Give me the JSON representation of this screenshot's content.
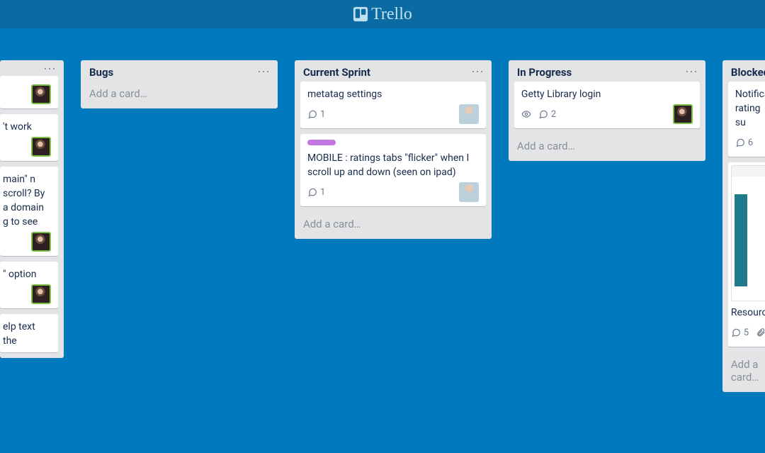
{
  "app": {
    "name": "Trello"
  },
  "add_card_label": "Add a card…",
  "lists": [
    {
      "id": "cutoff_left",
      "title": "",
      "cards": [
        {
          "title": "",
          "comments": null,
          "avatar": "av1"
        },
        {
          "title": "'t work",
          "comments": null,
          "avatar": "av1"
        },
        {
          "title": "main\" n scroll? By a domain g to see",
          "comments": null,
          "avatar": "av1"
        },
        {
          "title": "\" option",
          "comments": null,
          "avatar": "av1"
        },
        {
          "title": "elp text the",
          "comments": null,
          "avatar": null
        }
      ]
    },
    {
      "id": "bugs",
      "title": "Bugs",
      "cards": []
    },
    {
      "id": "current_sprint",
      "title": "Current Sprint",
      "cards": [
        {
          "title": "metatag settings",
          "comments": 1,
          "avatar": "av2"
        },
        {
          "title": "MOBILE : ratings tabs \"flicker\" when I scroll up and down (seen on ipad)",
          "label": "purple",
          "comments": 1,
          "avatar": "av2"
        }
      ]
    },
    {
      "id": "in_progress",
      "title": "In Progress",
      "cards": [
        {
          "title": "Getty Library login",
          "watch": true,
          "comments": 2,
          "avatar": "av1"
        }
      ]
    },
    {
      "id": "blocked",
      "title": "Blocked",
      "cards": [
        {
          "title": "Notificat rating su",
          "comments": 6
        },
        {
          "screenshot": true,
          "title": "Resource",
          "comments": 5,
          "attachments": true
        }
      ]
    }
  ]
}
